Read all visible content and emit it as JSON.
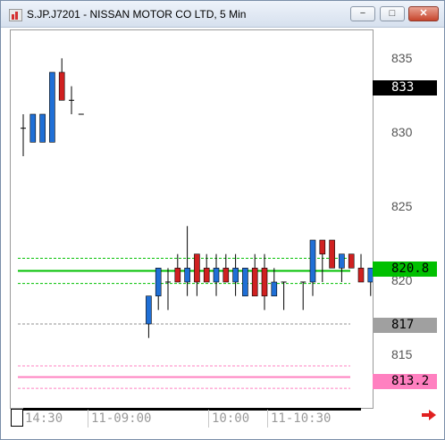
{
  "window": {
    "title": "S.JP.J7201 - NISSAN MOTOR CO LTD, 5 Min",
    "buttons": {
      "minimize": "−",
      "restore": "□",
      "close": "✕"
    }
  },
  "axis": {
    "price_ticks": [
      "835",
      "830",
      "825",
      "820",
      "815"
    ],
    "time_labels": [
      "14:30",
      "11-09:00",
      "10:00",
      "11-10:30"
    ]
  },
  "badges": {
    "last": {
      "text": "833",
      "bg": "#000000",
      "fg": "#ffffff"
    },
    "ma": {
      "text": "820.8",
      "bg": "#00c000",
      "fg": "#000000"
    },
    "gray": {
      "text": "817",
      "bg": "#a0a0a0",
      "fg": "#000000"
    },
    "pink": {
      "text": "813.2",
      "bg": "#ff80c0",
      "fg": "#000000"
    }
  },
  "colors": {
    "up": "#1f6fd6",
    "down": "#d02020",
    "ma": "#00c000",
    "pink": "#ff80c0",
    "gray": "#909090"
  },
  "chart_data": {
    "type": "candlestick",
    "ylim": [
      811,
      838
    ],
    "candles": [
      {
        "o": 831.0,
        "h": 832.0,
        "l": 829.0,
        "c": 831.0
      },
      {
        "o": 830.0,
        "h": 832.0,
        "l": 830.0,
        "c": 832.0
      },
      {
        "o": 830.0,
        "h": 832.0,
        "l": 830.0,
        "c": 832.0
      },
      {
        "o": 830.0,
        "h": 835.0,
        "l": 830.0,
        "c": 835.0
      },
      {
        "o": 835.0,
        "h": 836.0,
        "l": 833.0,
        "c": 833.0
      },
      {
        "o": 833.0,
        "h": 834.0,
        "l": 832.0,
        "c": 833.0
      },
      {
        "o": 832.0,
        "h": 832.0,
        "l": 832.0,
        "c": 832.0
      },
      null,
      null,
      null,
      null,
      null,
      null,
      {
        "o": 817.0,
        "h": 817.0,
        "l": 816.0,
        "c": 819.0
      },
      {
        "o": 819.0,
        "h": 821.0,
        "l": 818.0,
        "c": 821.0
      },
      {
        "o": 820.0,
        "h": 821.0,
        "l": 818.0,
        "c": 820.0
      },
      {
        "o": 821.0,
        "h": 822.0,
        "l": 820.0,
        "c": 820.0
      },
      {
        "o": 820.0,
        "h": 824.0,
        "l": 819.0,
        "c": 821.0
      },
      {
        "o": 822.0,
        "h": 822.0,
        "l": 819.0,
        "c": 820.0
      },
      {
        "o": 821.0,
        "h": 822.0,
        "l": 820.0,
        "c": 820.0
      },
      {
        "o": 820.0,
        "h": 822.0,
        "l": 819.0,
        "c": 821.0
      },
      {
        "o": 821.0,
        "h": 822.0,
        "l": 820.0,
        "c": 820.0
      },
      {
        "o": 820.0,
        "h": 822.0,
        "l": 819.0,
        "c": 821.0
      },
      {
        "o": 819.0,
        "h": 821.0,
        "l": 819.0,
        "c": 821.0
      },
      {
        "o": 821.0,
        "h": 822.0,
        "l": 820.0,
        "c": 819.0
      },
      {
        "o": 821.0,
        "h": 822.0,
        "l": 818.0,
        "c": 819.0
      },
      {
        "o": 819.0,
        "h": 821.0,
        "l": 819.0,
        "c": 820.0
      },
      {
        "o": 820.0,
        "h": 820.0,
        "l": 818.0,
        "c": 820.0
      },
      null,
      {
        "o": 820.0,
        "h": 820.0,
        "l": 818.0,
        "c": 820.0
      },
      {
        "o": 820.0,
        "h": 823.0,
        "l": 819.0,
        "c": 823.0
      },
      {
        "o": 823.0,
        "h": 823.0,
        "l": 820.0,
        "c": 822.0
      },
      {
        "o": 823.0,
        "h": 823.0,
        "l": 821.0,
        "c": 821.0
      },
      {
        "o": 821.0,
        "h": 822.0,
        "l": 820.0,
        "c": 822.0
      },
      {
        "o": 822.0,
        "h": 822.0,
        "l": 821.0,
        "c": 821.0
      },
      {
        "o": 821.0,
        "h": 822.0,
        "l": 820.0,
        "c": 820.0
      },
      {
        "o": 820.0,
        "h": 821.0,
        "l": 819.0,
        "c": 821.0
      },
      {
        "o": 820.0,
        "h": 821.0,
        "l": 820.0,
        "c": 820.0
      },
      {
        "o": 820.0,
        "h": 823.0,
        "l": 819.0,
        "c": 821.0
      },
      {
        "o": 821.0,
        "h": 821.0,
        "l": 820.0,
        "c": 820.0
      },
      {
        "o": 821.0,
        "h": 824.0,
        "l": 820.0,
        "c": 822.0
      },
      {
        "o": 822.0,
        "h": 823.0,
        "l": 822.0,
        "c": 822.0
      }
    ],
    "lines": [
      {
        "name": "",
        "value": 820.8,
        "style": "solid",
        "color": "#00c000"
      },
      {
        "name": "",
        "value": 821.7,
        "style": "dashed",
        "color": "#00c000"
      },
      {
        "name": "",
        "value": 819.9,
        "style": "dashed",
        "color": "#00c000"
      },
      {
        "name": "",
        "value": 817.0,
        "style": "dashed",
        "color": "#909090"
      },
      {
        "name": "",
        "value": 813.2,
        "style": "solid",
        "color": "#ff80c0"
      },
      {
        "name": "",
        "value": 814.0,
        "style": "dashed",
        "color": "#ff80c0"
      },
      {
        "name": "",
        "value": 812.4,
        "style": "dashed",
        "color": "#ff80c0"
      }
    ]
  }
}
